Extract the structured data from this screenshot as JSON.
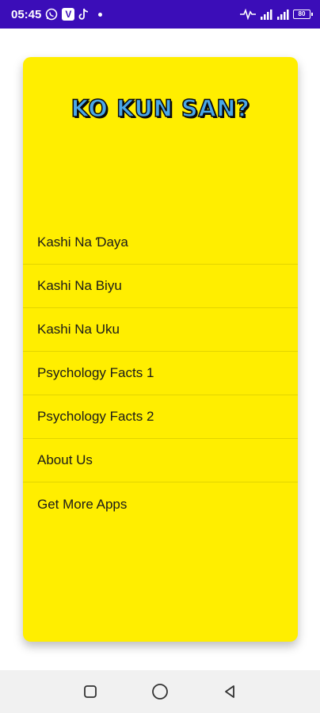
{
  "status_bar": {
    "time": "05:45",
    "v_badge": "V",
    "battery_label": "80"
  },
  "app": {
    "title": "KO KUN SAN?",
    "accent_color": "#ffee00",
    "title_color": "#4aa8e8"
  },
  "menu": {
    "items": [
      {
        "label": "Kashi Na Ɗaya"
      },
      {
        "label": "Kashi Na Biyu"
      },
      {
        "label": "Kashi Na Uku"
      },
      {
        "label": "Psychology Facts 1"
      },
      {
        "label": "Psychology Facts 2"
      },
      {
        "label": "About Us"
      },
      {
        "label": "Get More Apps"
      }
    ]
  },
  "nav_bar": {
    "buttons": [
      "square-recents-icon",
      "circle-home-icon",
      "triangle-back-icon"
    ]
  }
}
